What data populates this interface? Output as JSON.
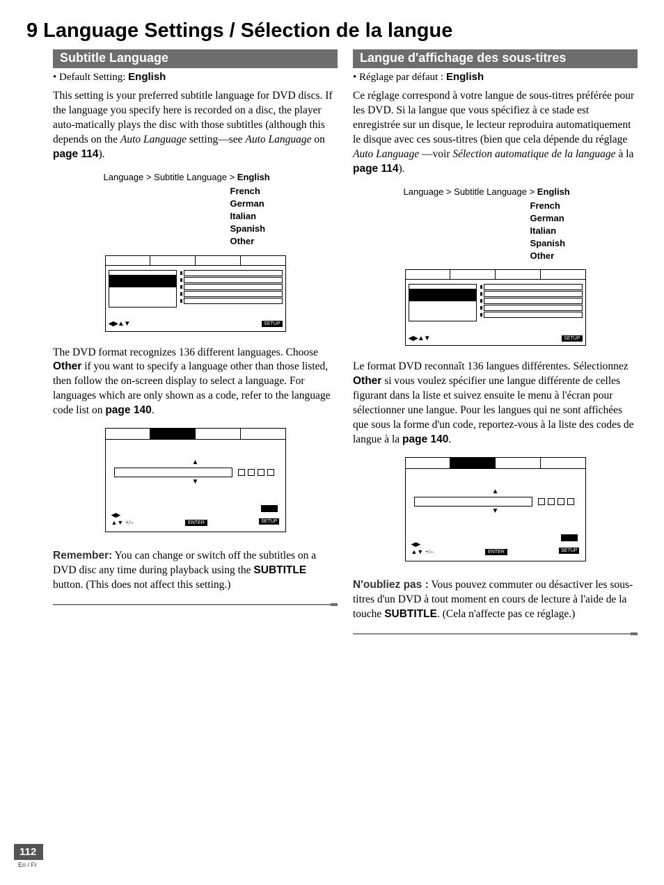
{
  "page_title": "9 Language Settings / Sélection de la langue",
  "left": {
    "header": "Subtitle Language",
    "default_label": "• Default Setting: ",
    "default_value": "English",
    "intro_a": "This setting is your preferred subtitle language for DVD discs. If the language you specify here is recorded on a disc, the player auto-matically plays the disc with those subtitles (although this depends on the ",
    "intro_em1": "Auto Language",
    "intro_b": " setting—see ",
    "intro_em2": "Auto Language",
    "intro_c": " on ",
    "intro_page": "page 114",
    "intro_end": ").",
    "menu_path_a": "Language > Subtitle Language > ",
    "menu_path_sel": "English",
    "menu_options": [
      "French",
      "German",
      "Italian",
      "Spanish",
      "Other"
    ],
    "para2_a": "The DVD format recognizes 136 different languages. Choose ",
    "para2_strong": "Other",
    "para2_b": " if you want to specify a language other than those listed, then follow the on-screen display to select a language. For languages which are only shown as a code, refer to the language code list on ",
    "para2_page": "page 140",
    "para2_end": ".",
    "remember_lead": "Remember:",
    "remember_a": " You can change or switch off the subtitles on a DVD disc any time during playback using the ",
    "remember_strong": "SUBTITLE",
    "remember_b": " button. (This does not affect this setting.)",
    "setup_label": "SETUP",
    "enter_label": "ENTER",
    "plusminus": "+/–"
  },
  "right": {
    "header": "Langue d'affichage des sous-titres",
    "default_label": "• Réglage par défaut : ",
    "default_value": "English",
    "intro_a": "Ce réglage correspond à votre langue de sous-titres préférée pour les DVD. Si la langue que vous spécifiez à ce stade est enregistrée sur un disque, le lecteur reproduira automatiquement le disque avec ces sous-titres (bien que cela dépende du réglage ",
    "intro_em1": "Auto Language",
    "intro_b": " —voir ",
    "intro_em2": "Sélection automatique de la language",
    "intro_c": " à la ",
    "intro_page": "page 114",
    "intro_end": ").",
    "menu_path_a": "Language > Subtitle Language > ",
    "menu_path_sel": "English",
    "menu_options": [
      "French",
      "German",
      "Italian",
      "Spanish",
      "Other"
    ],
    "para2_a": "Le format DVD reconnaît 136 langues différentes. Sélectionnez ",
    "para2_strong": "Other",
    "para2_b": " si vous voulez spécifier une langue différente de celles figurant dans la liste et suivez ensuite le menu à l'écran pour sélectionner une langue. Pour les langues qui ne sont affichées que sous la forme d'un code, reportez-vous à la liste des codes de langue à la ",
    "para2_page": "page 140",
    "para2_end": ".",
    "remember_lead": "N'oubliez pas :",
    "remember_a": " Vous pouvez commuter ou désactiver les sous-titres d'un DVD à tout moment en cours de lecture à l'aide de la touche ",
    "remember_strong": "SUBTITLE",
    "remember_b": ". (Cela n'affecte pas ce réglage.)",
    "setup_label": "SETUP",
    "enter_label": "ENTER",
    "plusminus": "+/–"
  },
  "footer": {
    "page_number": "112",
    "lang_code": "En / Fr"
  }
}
